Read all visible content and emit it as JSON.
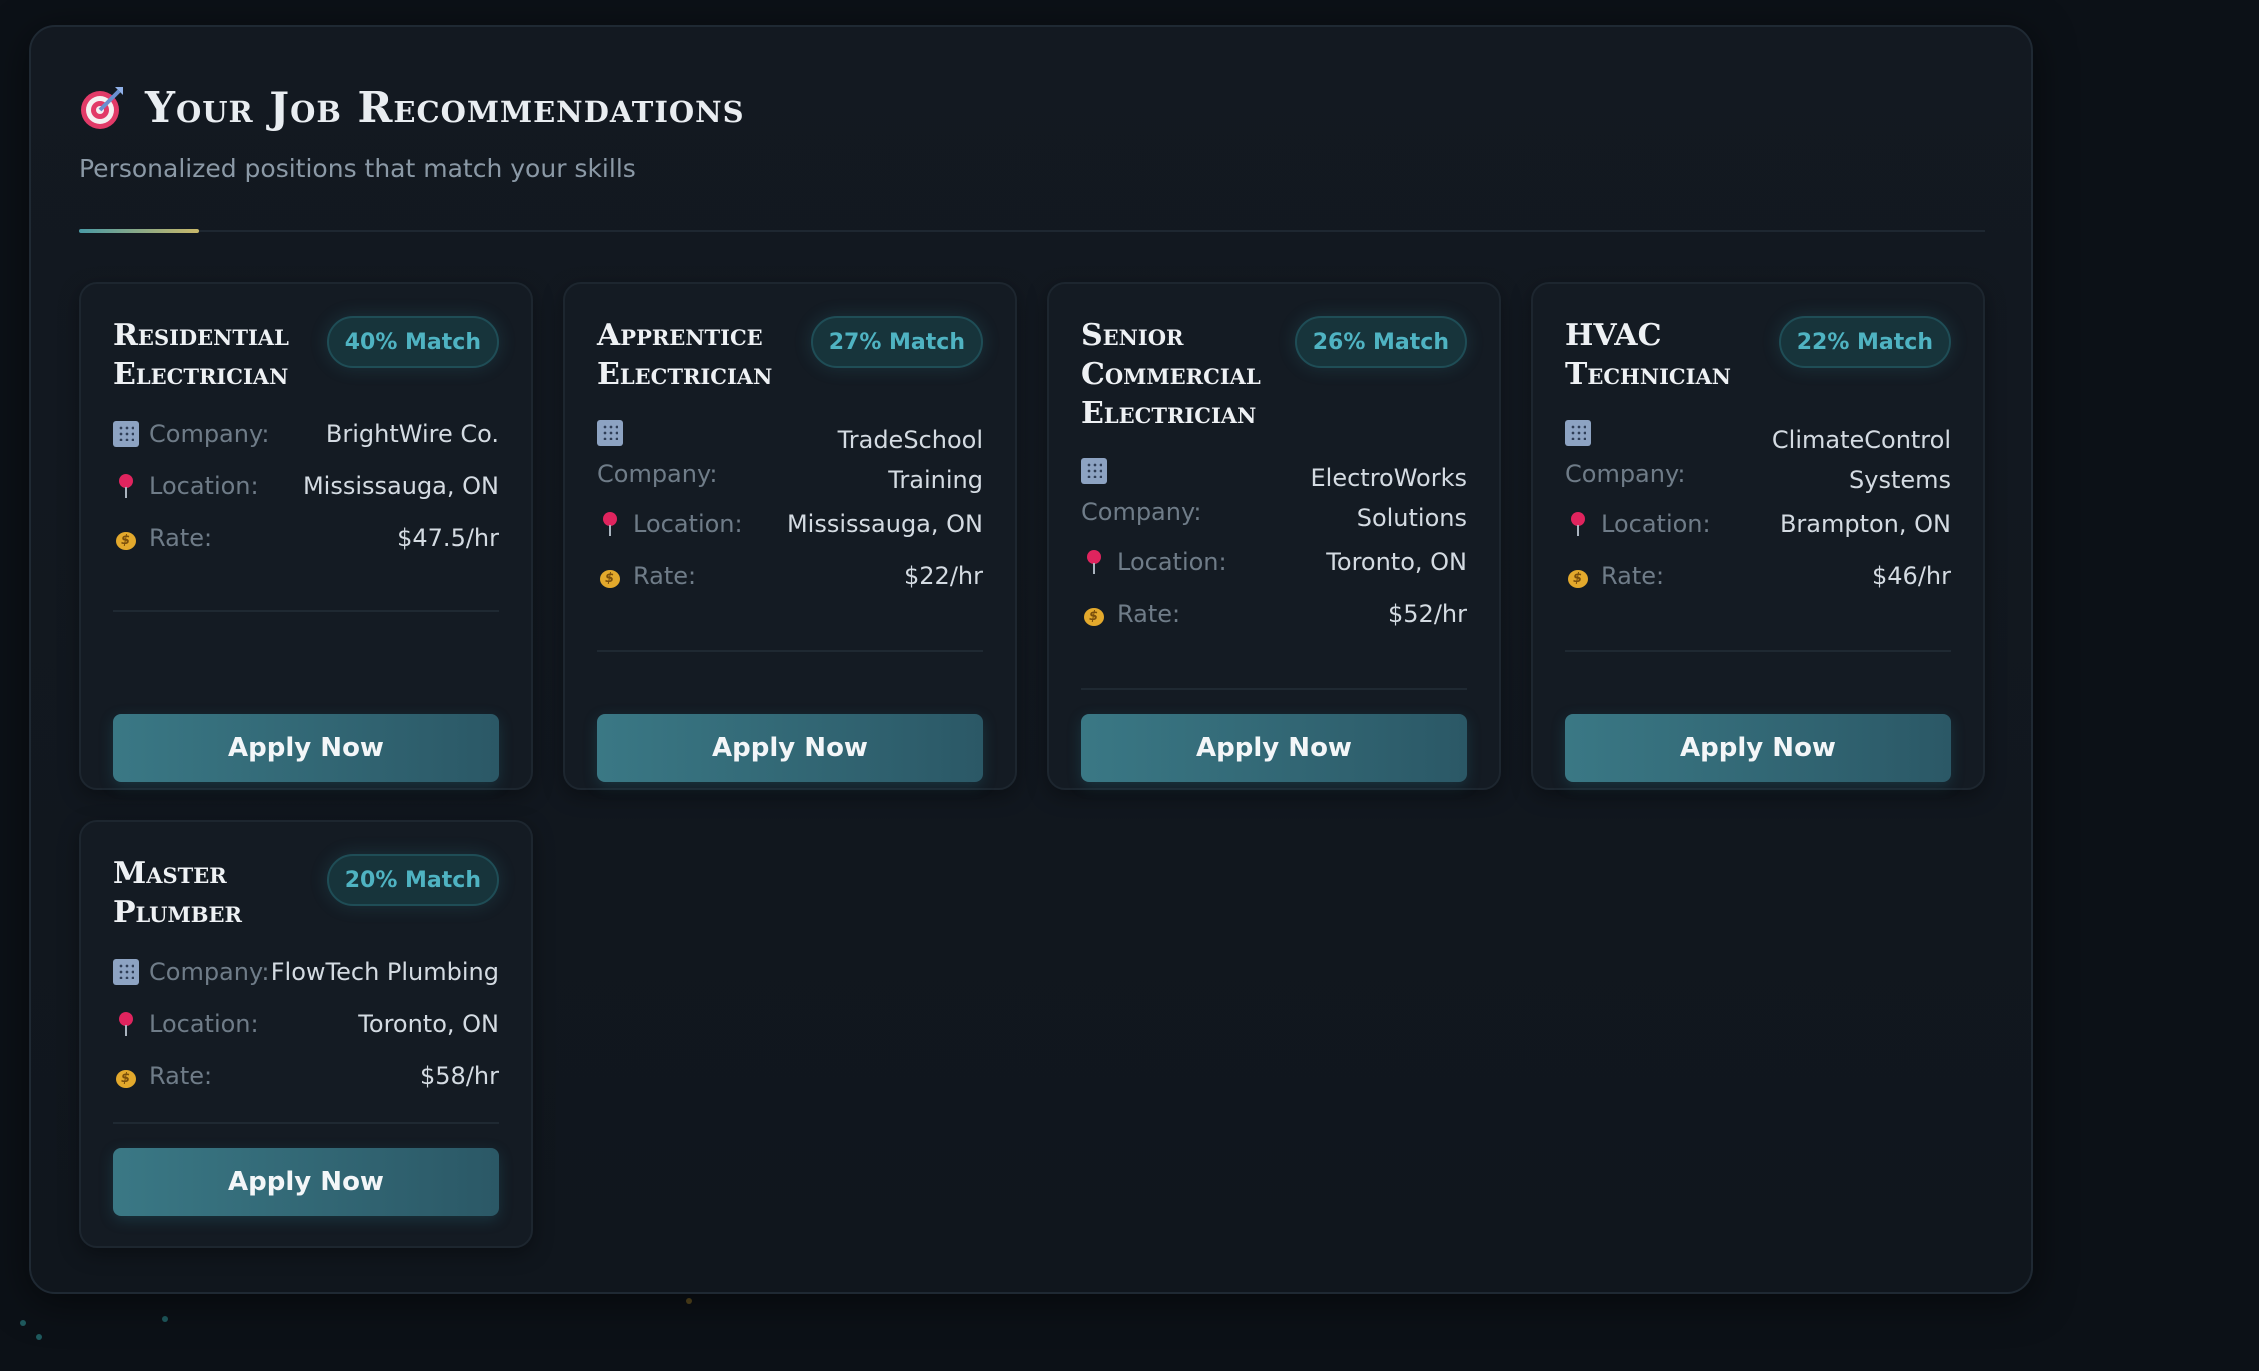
{
  "header": {
    "title": "Your Job Recommendations",
    "subtitle": "Personalized positions that match your skills",
    "icon": "target-icon"
  },
  "labels": {
    "company": "Company:",
    "location": "Location:",
    "rate": "Rate:",
    "apply": "Apply Now"
  },
  "jobs": [
    {
      "title": "Residential Electrician",
      "match": "40% Match",
      "company": "BrightWire Co.",
      "location": "Mississauga, ON",
      "rate": "$47.5/hr"
    },
    {
      "title": "Apprentice Electrician",
      "match": "27% Match",
      "company": "TradeSchool Training",
      "location": "Mississauga, ON",
      "rate": "$22/hr"
    },
    {
      "title": "Senior Commercial Electrician",
      "match": "26% Match",
      "company": "ElectroWorks Solutions",
      "location": "Toronto, ON",
      "rate": "$52/hr"
    },
    {
      "title": "HVAC Technician",
      "match": "22% Match",
      "company": "ClimateControl Systems",
      "location": "Brampton, ON",
      "rate": "$46/hr"
    },
    {
      "title": "Master Plumber",
      "match": "20% Match",
      "company": "FlowTech Plumbing",
      "location": "Toronto, ON",
      "rate": "$58/hr"
    }
  ],
  "colors": {
    "background": "#0c1117",
    "panel": "#131921",
    "accent": "#4fb3c2",
    "button": "#3a7885"
  }
}
